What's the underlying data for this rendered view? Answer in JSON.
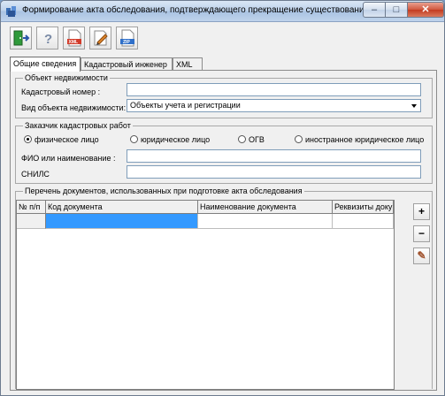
{
  "window": {
    "title": "Формирование акта обследования, подтверждающего прекращение существования ...",
    "min_glyph": "–",
    "max_glyph": "□",
    "close_glyph": "✕"
  },
  "toolbar": {
    "buttons": [
      {
        "icon": "exit-door-icon"
      },
      {
        "icon": "help-icon",
        "glyph": "?"
      },
      {
        "icon": "xml-export-icon",
        "label": "XML"
      },
      {
        "icon": "edit-document-icon"
      },
      {
        "icon": "zip-export-icon",
        "label": "ZIP"
      }
    ]
  },
  "tabs": [
    {
      "label": "Общие сведения",
      "active": true
    },
    {
      "label": "Кадастровый инженер",
      "active": false
    },
    {
      "label": "XML",
      "active": false
    }
  ],
  "property": {
    "legend": "Объект недвижимости",
    "cadastral_label": "Кадастровый номер :",
    "cadastral_value": "",
    "type_label": "Вид объекта недвижимости:",
    "type_value": "Объекты учета и регистрации"
  },
  "customer": {
    "legend": "Заказчик кадастровых работ",
    "options": [
      {
        "label": "физическое лицо",
        "checked": true
      },
      {
        "label": "юридическое лицо",
        "checked": false
      },
      {
        "label": "ОГВ",
        "checked": false
      },
      {
        "label": "иностранное юридическое лицо",
        "checked": false
      }
    ],
    "fio_label": "ФИО или наименование :",
    "fio_value": "",
    "snils_label": "СНИЛС",
    "snils_value": ""
  },
  "documents": {
    "legend": "Перечень документов, использованных при подготовке акта обследования",
    "columns": [
      "№ п/п",
      "Код документа",
      "Наименование документа",
      "Реквизиты доку"
    ],
    "rows": [
      [
        "",
        "",
        "",
        ""
      ]
    ],
    "add_glyph": "+",
    "remove_glyph": "−",
    "edit_glyph": "✎"
  },
  "colors": {
    "selection": "#3399ff",
    "close_button": "#c33a1f",
    "title_gradient": "#bcd1ea"
  }
}
